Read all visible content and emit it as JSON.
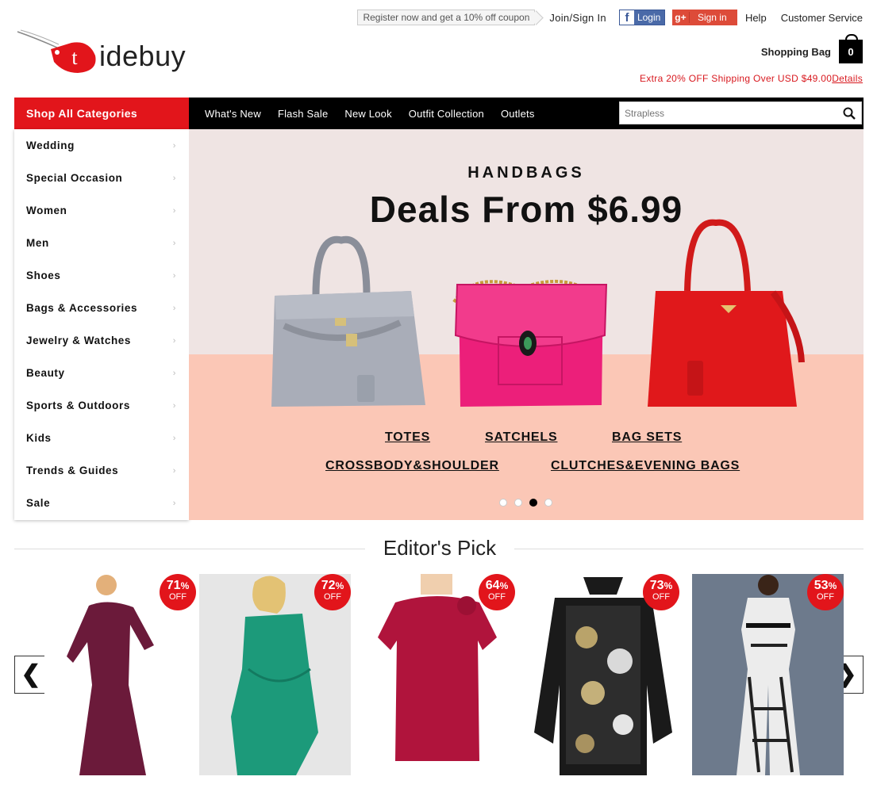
{
  "header": {
    "coupon": "Register now and get a 10% off coupon",
    "join": "Join/Sign In",
    "facebook_login": "Login",
    "google_signin": "Sign in",
    "help": "Help",
    "customer_service": "Customer Service",
    "logo_letter": "t",
    "logo_text": "idebuy",
    "shopping_bag_label": "Shopping Bag",
    "shopping_bag_count": "0",
    "promo_text": "Extra 20% OFF Shipping Over USD $49.00",
    "promo_link": "Details"
  },
  "nav": {
    "shop_all": "Shop All Categories",
    "links": [
      "What's New",
      "Flash Sale",
      "New Look",
      "Outfit Collection",
      "Outlets"
    ],
    "search_placeholder": "Strapless"
  },
  "sidebar": {
    "items": [
      "Wedding",
      "Special Occasion",
      "Women",
      "Men",
      "Shoes",
      "Bags & Accessories",
      "Jewelry & Watches",
      "Beauty",
      "Sports & Outdoors",
      "Kids",
      "Trends & Guides",
      "Sale"
    ],
    "chevron": "›"
  },
  "hero": {
    "subtitle": "HANDBAGS",
    "title": "Deals From $6.99",
    "links": [
      "TOTES",
      "SATCHELS",
      "BAG SETS",
      "CROSSBODY&SHOULDER",
      "CLUTCHES&EVENING BAGS"
    ],
    "active_slide_index": 2,
    "slide_count": 4
  },
  "editors_pick": {
    "title": "Editor's Pick",
    "prev": "❮",
    "next": "❯",
    "products": [
      {
        "discount": "71",
        "off": "OFF",
        "color": "#6b1a3a"
      },
      {
        "discount": "72",
        "off": "OFF",
        "color": "#1c9a7a"
      },
      {
        "discount": "64",
        "off": "OFF",
        "color": "#b0143c"
      },
      {
        "discount": "73",
        "off": "OFF",
        "color": "#1a1a1a"
      },
      {
        "discount": "53",
        "off": "OFF",
        "color": "#e8e8e8"
      }
    ]
  },
  "colors": {
    "brand_red": "#e2151b",
    "nav_black": "#000000",
    "facebook_blue": "#4a6aa8",
    "google_red": "#dd4b39"
  }
}
